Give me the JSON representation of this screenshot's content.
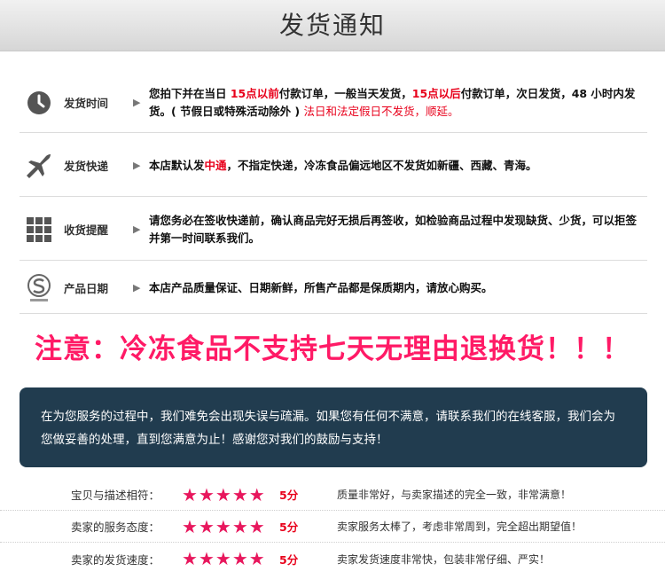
{
  "header": {
    "title": "发货通知"
  },
  "rows": [
    {
      "icon": "clock-icon",
      "label": "发货时间",
      "parts": [
        "您拍下并在当日 ",
        "15点以前",
        "付款订单，一般当天发货，",
        "15点以后",
        "付款订单，次日发货，48 小时内发货。( 节假日或特殊活动除外 ) ",
        "法日和法定假日不发货，顺延。"
      ]
    },
    {
      "icon": "airplane-icon",
      "label": "发货快递",
      "parts": [
        "本店默认发",
        "中通",
        "，不指定快递，冷冻食品偏远地区不发货如新疆、西藏、青海。"
      ]
    },
    {
      "icon": "grid-icon",
      "label": "收货提醒",
      "text": "请您务必在签收快递前，确认商品完好无损后再签收，如检验商品过程中发现缺货、少货，可以拒签并第一时间联系我们。"
    },
    {
      "icon": "quality-seal-icon",
      "label": "产品日期",
      "text": "本店产品质量保证、日期新鲜，所售产品都是保质期内，请放心购买。"
    }
  ],
  "notice": "注意：冷冻食品不支持七天无理由退换货！！！",
  "service_text": "在为您服务的过程中，我们难免会出现失误与疏漏。如果您有任何不满意，请联系我们的在线客服，我们会为您做妥善的处理，直到您满意为止！感谢您对我们的鼓励与支持！",
  "ratings": [
    {
      "label": "宝贝与描述相符：",
      "stars": 5,
      "score": "5分",
      "comment": "质量非常好，与卖家描述的完全一致，非常满意！"
    },
    {
      "label": "卖家的服务态度：",
      "stars": 5,
      "score": "5分",
      "comment": "卖家服务太棒了，考虑非常周到，完全超出期望值！"
    },
    {
      "label": "卖家的发货速度：",
      "stars": 5,
      "score": "5分",
      "comment": "卖家发货速度非常快，包装非常仔细、严实！"
    }
  ],
  "colors": {
    "accent_red": "#e8001b",
    "notice_pink": "#ff1a66",
    "panel": "#213c4f",
    "star": "#e8175d"
  }
}
